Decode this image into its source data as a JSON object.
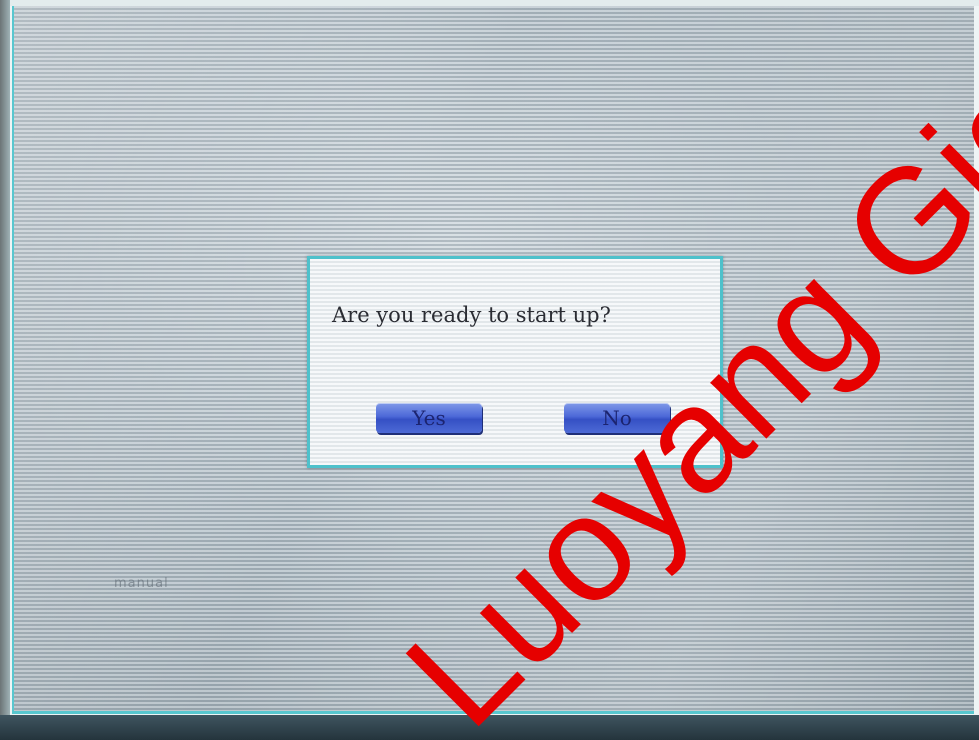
{
  "dialog": {
    "message": "Are you ready to start up?",
    "yes_label": "Yes",
    "no_label": "No"
  },
  "background_label": "manual",
  "watermark": {
    "text": "Luoyang Giga",
    "color": "#e60000"
  },
  "colors": {
    "dialog_border": "#4ec1cb",
    "button_blue": "#4c68d8",
    "screen_bezel": "#58c7cf"
  }
}
